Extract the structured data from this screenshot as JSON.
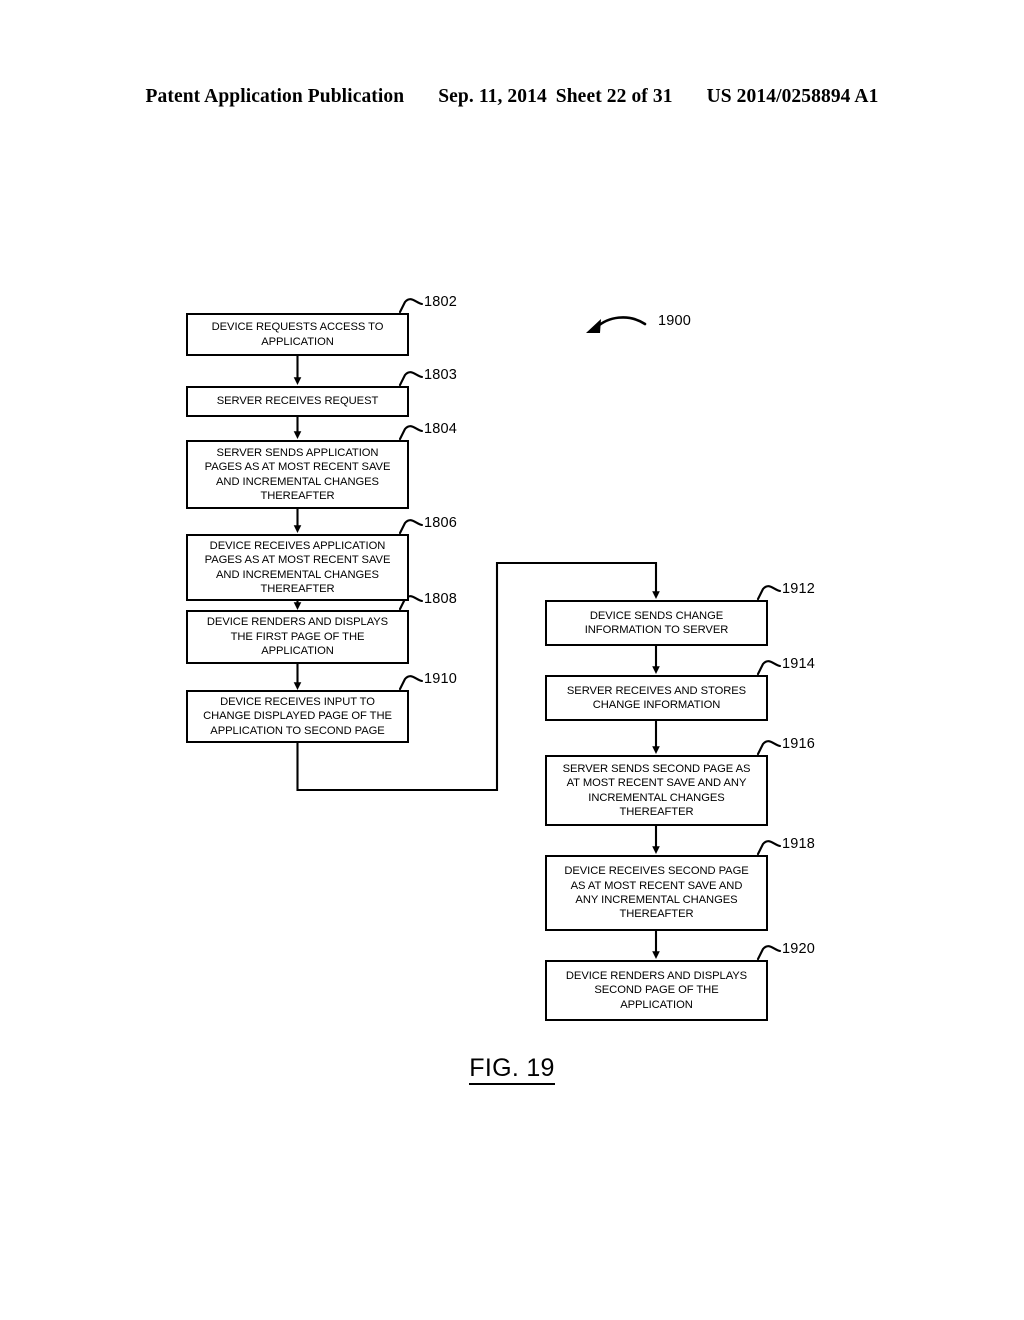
{
  "header": {
    "publication": "Patent Application Publication",
    "date": "Sep. 11, 2014",
    "sheet": "Sheet 22 of 31",
    "patent_number": "US 2014/0258894 A1"
  },
  "figure": {
    "caption": "FIG. 19",
    "diagram_label": "1900"
  },
  "boxes": [
    {
      "ref": "1802",
      "text": "DEVICE REQUESTS ACCESS TO\nAPPLICATION"
    },
    {
      "ref": "1803",
      "text": "SERVER RECEIVES REQUEST"
    },
    {
      "ref": "1804",
      "text": "SERVER SENDS APPLICATION\nPAGES AS AT MOST RECENT SAVE\nAND INCREMENTAL CHANGES\nTHEREAFTER"
    },
    {
      "ref": "1806",
      "text": "DEVICE RECEIVES APPLICATION\nPAGES AS AT MOST RECENT SAVE\nAND INCREMENTAL CHANGES\nTHEREAFTER"
    },
    {
      "ref": "1808",
      "text": "DEVICE RENDERS AND DISPLAYS\nTHE FIRST PAGE OF THE\nAPPLICATION"
    },
    {
      "ref": "1910",
      "text": "DEVICE RECEIVES INPUT TO\nCHANGE DISPLAYED PAGE OF THE\nAPPLICATION TO SECOND PAGE"
    },
    {
      "ref": "1912",
      "text": "DEVICE SENDS CHANGE\nINFORMATION TO SERVER"
    },
    {
      "ref": "1914",
      "text": "SERVER RECEIVES AND STORES\nCHANGE INFORMATION"
    },
    {
      "ref": "1916",
      "text": "SERVER SENDS SECOND PAGE AS\nAT MOST RECENT SAVE AND ANY\nINCREMENTAL CHANGES\nTHEREAFTER"
    },
    {
      "ref": "1918",
      "text": "DEVICE RECEIVES SECOND PAGE\nAS AT MOST RECENT SAVE AND\nANY INCREMENTAL CHANGES\nTHEREAFTER"
    },
    {
      "ref": "1920",
      "text": "DEVICE RENDERS AND DISPLAYS\nSECOND  PAGE OF THE\nAPPLICATION"
    }
  ],
  "colors": {
    "ink": "#000000",
    "paper": "#ffffff"
  }
}
